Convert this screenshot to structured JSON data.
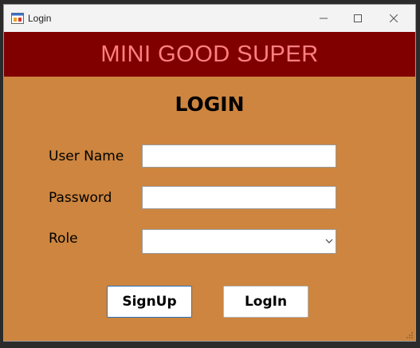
{
  "window": {
    "title": "Login"
  },
  "banner": {
    "text": "MINI GOOD SUPER"
  },
  "form": {
    "heading": "LOGIN",
    "username_label": "User Name",
    "username_value": "",
    "password_label": "Password",
    "password_value": "",
    "role_label": "Role",
    "role_selected": ""
  },
  "buttons": {
    "signup": "SignUp",
    "login": "LogIn"
  },
  "colors": {
    "background": "#cd853f",
    "banner_bg": "#800000",
    "banner_text": "#ff8080",
    "titlebar": "#f3f3f3"
  },
  "icons": [
    "app-icon",
    "minimize-icon",
    "maximize-icon",
    "close-icon",
    "chevron-down-icon",
    "resize-grip-icon"
  ]
}
